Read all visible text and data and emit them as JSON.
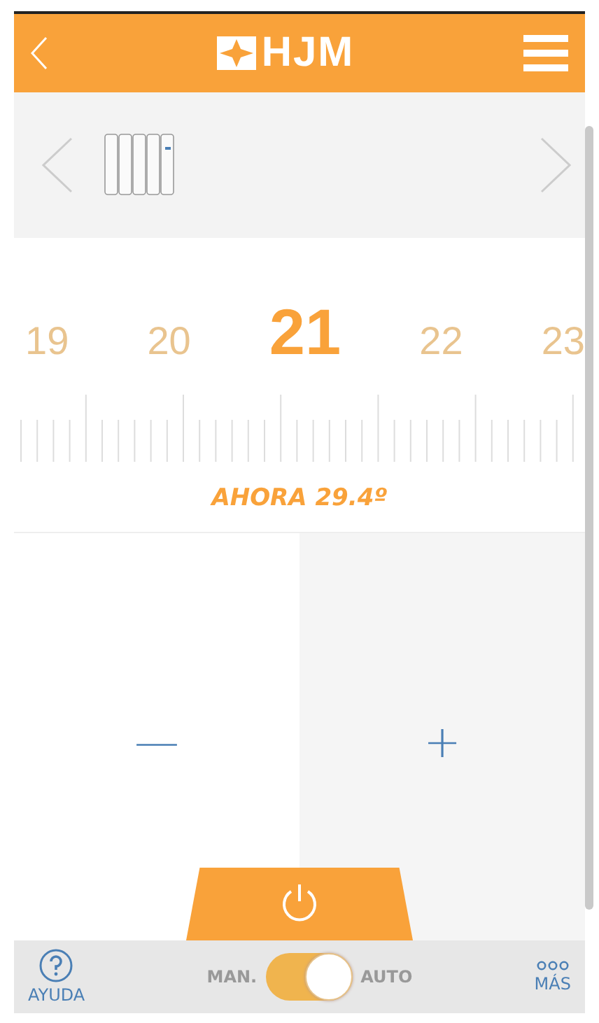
{
  "header": {
    "logo_text": "HJM"
  },
  "scale": {
    "numbers": [
      {
        "label": "19",
        "selected": false
      },
      {
        "label": "20",
        "selected": false
      },
      {
        "label": "21",
        "selected": true
      },
      {
        "label": "22",
        "selected": false
      },
      {
        "label": "23",
        "selected": false
      }
    ],
    "current": "AHORA 29.4º"
  },
  "controls": {
    "minus": "—",
    "plus": "+"
  },
  "bottom_bar": {
    "help": "AYUDA",
    "mode_left": "MAN.",
    "mode_right": "AUTO",
    "auto_on": true,
    "more": "MÁS"
  }
}
